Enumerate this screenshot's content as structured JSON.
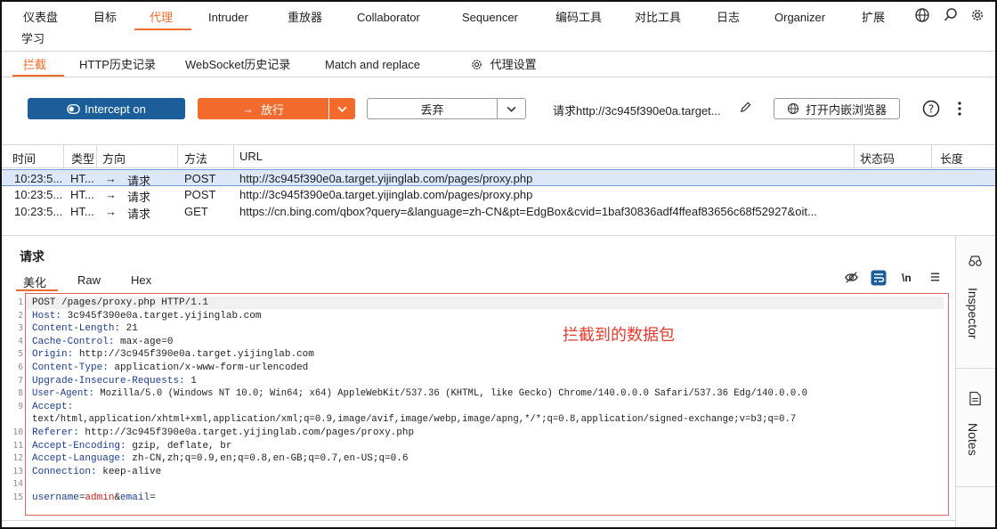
{
  "topnav": {
    "tabs": [
      "仪表盘",
      "目标",
      "代理",
      "Intruder",
      "重放器",
      "Collaborator",
      "Sequencer",
      "编码工具",
      "对比工具",
      "日志",
      "Organizer",
      "扩展"
    ],
    "second_row": "学习",
    "active": "代理",
    "icons": [
      "globe-icon",
      "search-icon",
      "gear-icon"
    ]
  },
  "subtabs": [
    "拦截",
    "HTTP历史记录",
    "WebSocket历史记录",
    "Match and replace",
    "代理设置"
  ],
  "toolbar": {
    "intercept_label": "Intercept on",
    "forward_label": "放行",
    "drop_label": "丢弃",
    "request_label": "请求http://3c945f390e0a.target...",
    "browser_label": "打开内嵌浏览器",
    "accent": "#f26b2c",
    "intercept_color": "#1c5e9a"
  },
  "table": {
    "columns": [
      "时间",
      "类型",
      "方向",
      "方法",
      "URL",
      "状态码",
      "长度"
    ],
    "rows": [
      {
        "time": "10:23:5...",
        "type": "HT...",
        "arrow": "→",
        "dir": "请求",
        "method": "POST",
        "url": "http://3c945f390e0a.target.yijinglab.com/pages/proxy.php"
      },
      {
        "time": "10:23:5...",
        "type": "HT...",
        "arrow": "→",
        "dir": "请求",
        "method": "POST",
        "url": "http://3c945f390e0a.target.yijinglab.com/pages/proxy.php"
      },
      {
        "time": "10:23:5...",
        "type": "HT...",
        "arrow": "→",
        "dir": "请求",
        "method": "GET",
        "url": "https://cn.bing.com/qbox?query=&language=zh-CN&pt=EdgBox&cvid=1baf30836adf4ffeaf83656c68f52927&oit..."
      }
    ]
  },
  "request_pane": {
    "title": "请求",
    "tabs": [
      "美化",
      "Raw",
      "Hex"
    ],
    "newline_label": "\\n",
    "annotation": "拦截到的数据包",
    "line_numbers": [
      "1",
      "2",
      "3",
      "4",
      "5",
      "6",
      "7",
      "8",
      "9",
      "",
      "10",
      "11",
      "12",
      "13",
      "14",
      "15"
    ],
    "lines": [
      {
        "name": "",
        "value": "POST /pages/proxy.php HTTP/1.1"
      },
      {
        "name": "Host:",
        "value": " 3c945f390e0a.target.yijinglab.com"
      },
      {
        "name": "Content-Length:",
        "value": " 21"
      },
      {
        "name": "Cache-Control:",
        "value": " max-age=0"
      },
      {
        "name": "Origin:",
        "value": " http://3c945f390e0a.target.yijinglab.com"
      },
      {
        "name": "Content-Type:",
        "value": " application/x-www-form-urlencoded"
      },
      {
        "name": "Upgrade-Insecure-Requests:",
        "value": " 1"
      },
      {
        "name": "User-Agent:",
        "value": " Mozilla/5.0 (Windows NT 10.0; Win64; x64) AppleWebKit/537.36 (KHTML, like Gecko) Chrome/140.0.0.0 Safari/537.36 Edg/140.0.0.0"
      },
      {
        "name": "Accept:",
        "value": ""
      },
      {
        "name": "",
        "value": "text/html,application/xhtml+xml,application/xml;q=0.9,image/avif,image/webp,image/apng,*/*;q=0.8,application/signed-exchange;v=b3;q=0.7"
      },
      {
        "name": "Referer:",
        "value": " http://3c945f390e0a.target.yijinglab.com/pages/proxy.php"
      },
      {
        "name": "Accept-Encoding:",
        "value": " gzip, deflate, br"
      },
      {
        "name": "Accept-Language:",
        "value": " zh-CN,zh;q=0.9,en;q=0.8,en-GB;q=0.7,en-US;q=0.6"
      },
      {
        "name": "Connection:",
        "value": " keep-alive"
      },
      {
        "name": "",
        "value": ""
      }
    ],
    "body": {
      "k1": "username",
      "eq1": "=",
      "v1": "admin",
      "amp": "&",
      "k2": "email",
      "eq2": "="
    }
  },
  "sidebar": {
    "inspector": "Inspector",
    "notes": "Notes"
  }
}
